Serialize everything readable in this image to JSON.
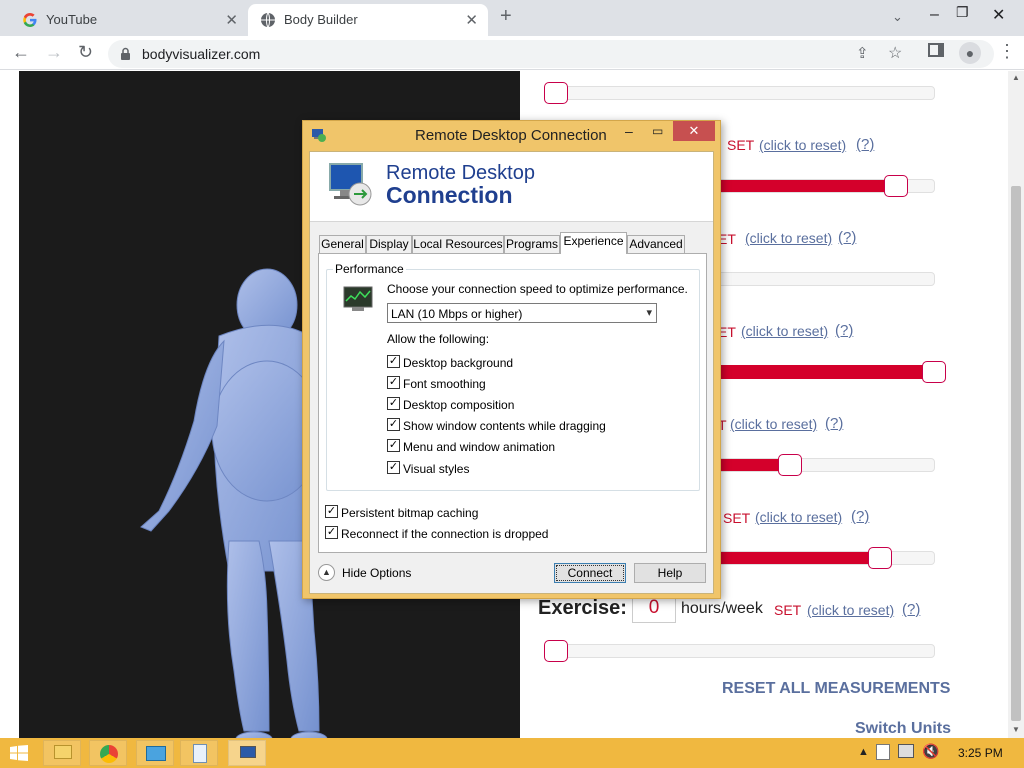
{
  "browser": {
    "tabs": [
      {
        "title": "YouTube",
        "icon": "google-g-icon"
      },
      {
        "title": "Body Builder",
        "icon": "globe-icon"
      }
    ],
    "new_tab": "+",
    "url": "bodyvisualizer.com"
  },
  "page": {
    "rows": [
      {
        "set": "SET",
        "reset": "(click to reset)",
        "help": "(?)"
      },
      {
        "set": "SET",
        "reset": "(click to reset)",
        "help": "(?)"
      },
      {
        "set": "SET",
        "reset": "(click to reset)",
        "help": "(?)"
      },
      {
        "set": "SET",
        "reset": "(click to reset)",
        "help": "(?)"
      },
      {
        "set": "SET",
        "reset": "(click to reset)",
        "help": "(?)"
      }
    ],
    "sliders": [
      0.0,
      0.92,
      0.0,
      1.0,
      0.63,
      0.89,
      0.0
    ],
    "exercise": {
      "label": "Exercise:",
      "value": "0",
      "unit": "hours/week",
      "set": "SET",
      "reset": "(click to reset)",
      "help": "(?)"
    },
    "reset_all": "RESET ALL MEASUREMENTS",
    "switch_units": "Switch Units"
  },
  "rdc": {
    "window_title": "Remote Desktop Connection",
    "banner_line1": "Remote Desktop",
    "banner_line2": "Connection",
    "tabs": [
      "General",
      "Display",
      "Local Resources",
      "Programs",
      "Experience",
      "Advanced"
    ],
    "active_tab": "Experience",
    "performance_group": "Performance",
    "speed_prompt": "Choose your connection speed to optimize performance.",
    "speed_value": "LAN (10 Mbps or higher)",
    "allow_label": "Allow the following:",
    "options": [
      {
        "label": "Desktop background",
        "checked": true
      },
      {
        "label": "Font smoothing",
        "checked": true
      },
      {
        "label": "Desktop composition",
        "checked": true
      },
      {
        "label": "Show window contents while dragging",
        "checked": true
      },
      {
        "label": "Menu and window animation",
        "checked": true
      },
      {
        "label": "Visual styles",
        "checked": true
      }
    ],
    "persistent": {
      "label": "Persistent bitmap caching",
      "checked": true
    },
    "reconnect": {
      "label": "Reconnect if the connection is dropped",
      "checked": true
    },
    "hide_options": "Hide Options",
    "connect": "Connect",
    "help": "Help"
  },
  "taskbar": {
    "time": "3:25 PM"
  },
  "colors": {
    "accent_red": "#d4002b",
    "link": "#5a6f9e",
    "taskbar": "#f0b840",
    "model": "#8fa8dc"
  }
}
